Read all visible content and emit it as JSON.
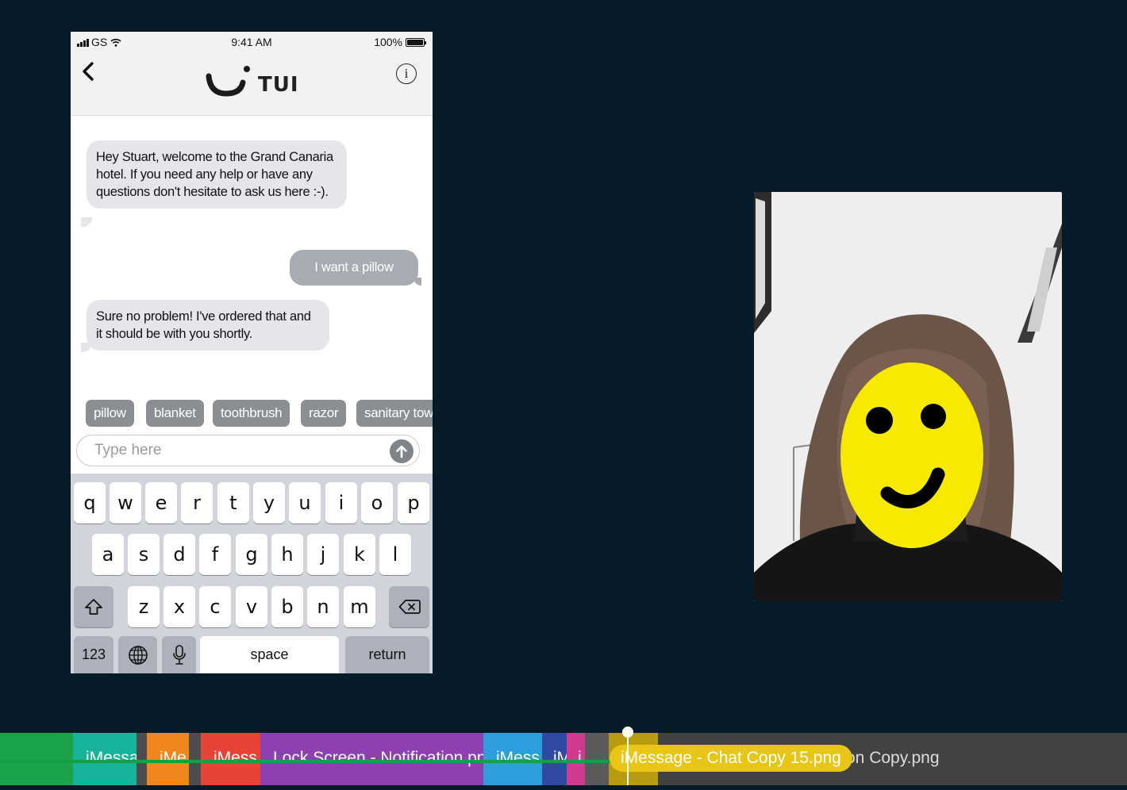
{
  "phone": {
    "status": {
      "carrier": "GS",
      "time": "9:41 AM",
      "battery": "100%"
    },
    "brand": {
      "logo_text": "TUI"
    },
    "messages": [
      {
        "direction": "incoming",
        "text": "Hey Stuart, welcome to the Grand Canaria hotel. If you need any help or have any questions don't hesitate to ask us here :-)."
      },
      {
        "direction": "outgoing",
        "text": "I want a pillow"
      },
      {
        "direction": "incoming",
        "text": "Sure no problem! I've ordered that and it should be with you shortly."
      }
    ],
    "quick_replies": [
      "pillow",
      "blanket",
      "toothbrush",
      "razor",
      "sanitary tow"
    ],
    "input": {
      "placeholder": "Type here",
      "value": ""
    },
    "keyboard": {
      "row1": [
        "q",
        "w",
        "e",
        "r",
        "t",
        "y",
        "u",
        "i",
        "o",
        "p"
      ],
      "row2": [
        "a",
        "s",
        "d",
        "f",
        "g",
        "h",
        "j",
        "k",
        "l"
      ],
      "row3": [
        "z",
        "x",
        "c",
        "v",
        "b",
        "n",
        "m"
      ],
      "numbers_key": "123",
      "space_key": "space",
      "return_key": "return"
    }
  },
  "video": {
    "subject": "person with yellow smiley face drawn over face",
    "icon": "webcam-feed"
  },
  "timeline": {
    "segments": [
      {
        "label": "",
        "color": "#1aa34a"
      },
      {
        "label": "iMessa",
        "color": "#17b39a"
      },
      {
        "label": "",
        "color": "#4d4d4d"
      },
      {
        "label": "iMe",
        "color": "#f0861e"
      },
      {
        "label": "",
        "color": "#4d4d4d"
      },
      {
        "label": "iMess",
        "color": "#e74437"
      },
      {
        "label": "Lock Screen - Notification.pn",
        "color": "#8e3fb0"
      },
      {
        "label": "iMess",
        "color": "#2e9ddc"
      },
      {
        "label": "iM",
        "color": "#2f4aa0"
      },
      {
        "label": "i",
        "color": "#d13a8e"
      },
      {
        "label": "",
        "color": "#5a5a5a"
      },
      {
        "label": "",
        "color": "#b89c10"
      }
    ],
    "active_clip": "iMessage - Chat Copy 15.png",
    "next_clip": "on Copy.png",
    "colors": {
      "progress": "#14a046",
      "active": "#e8c617",
      "track": "#424242"
    }
  }
}
